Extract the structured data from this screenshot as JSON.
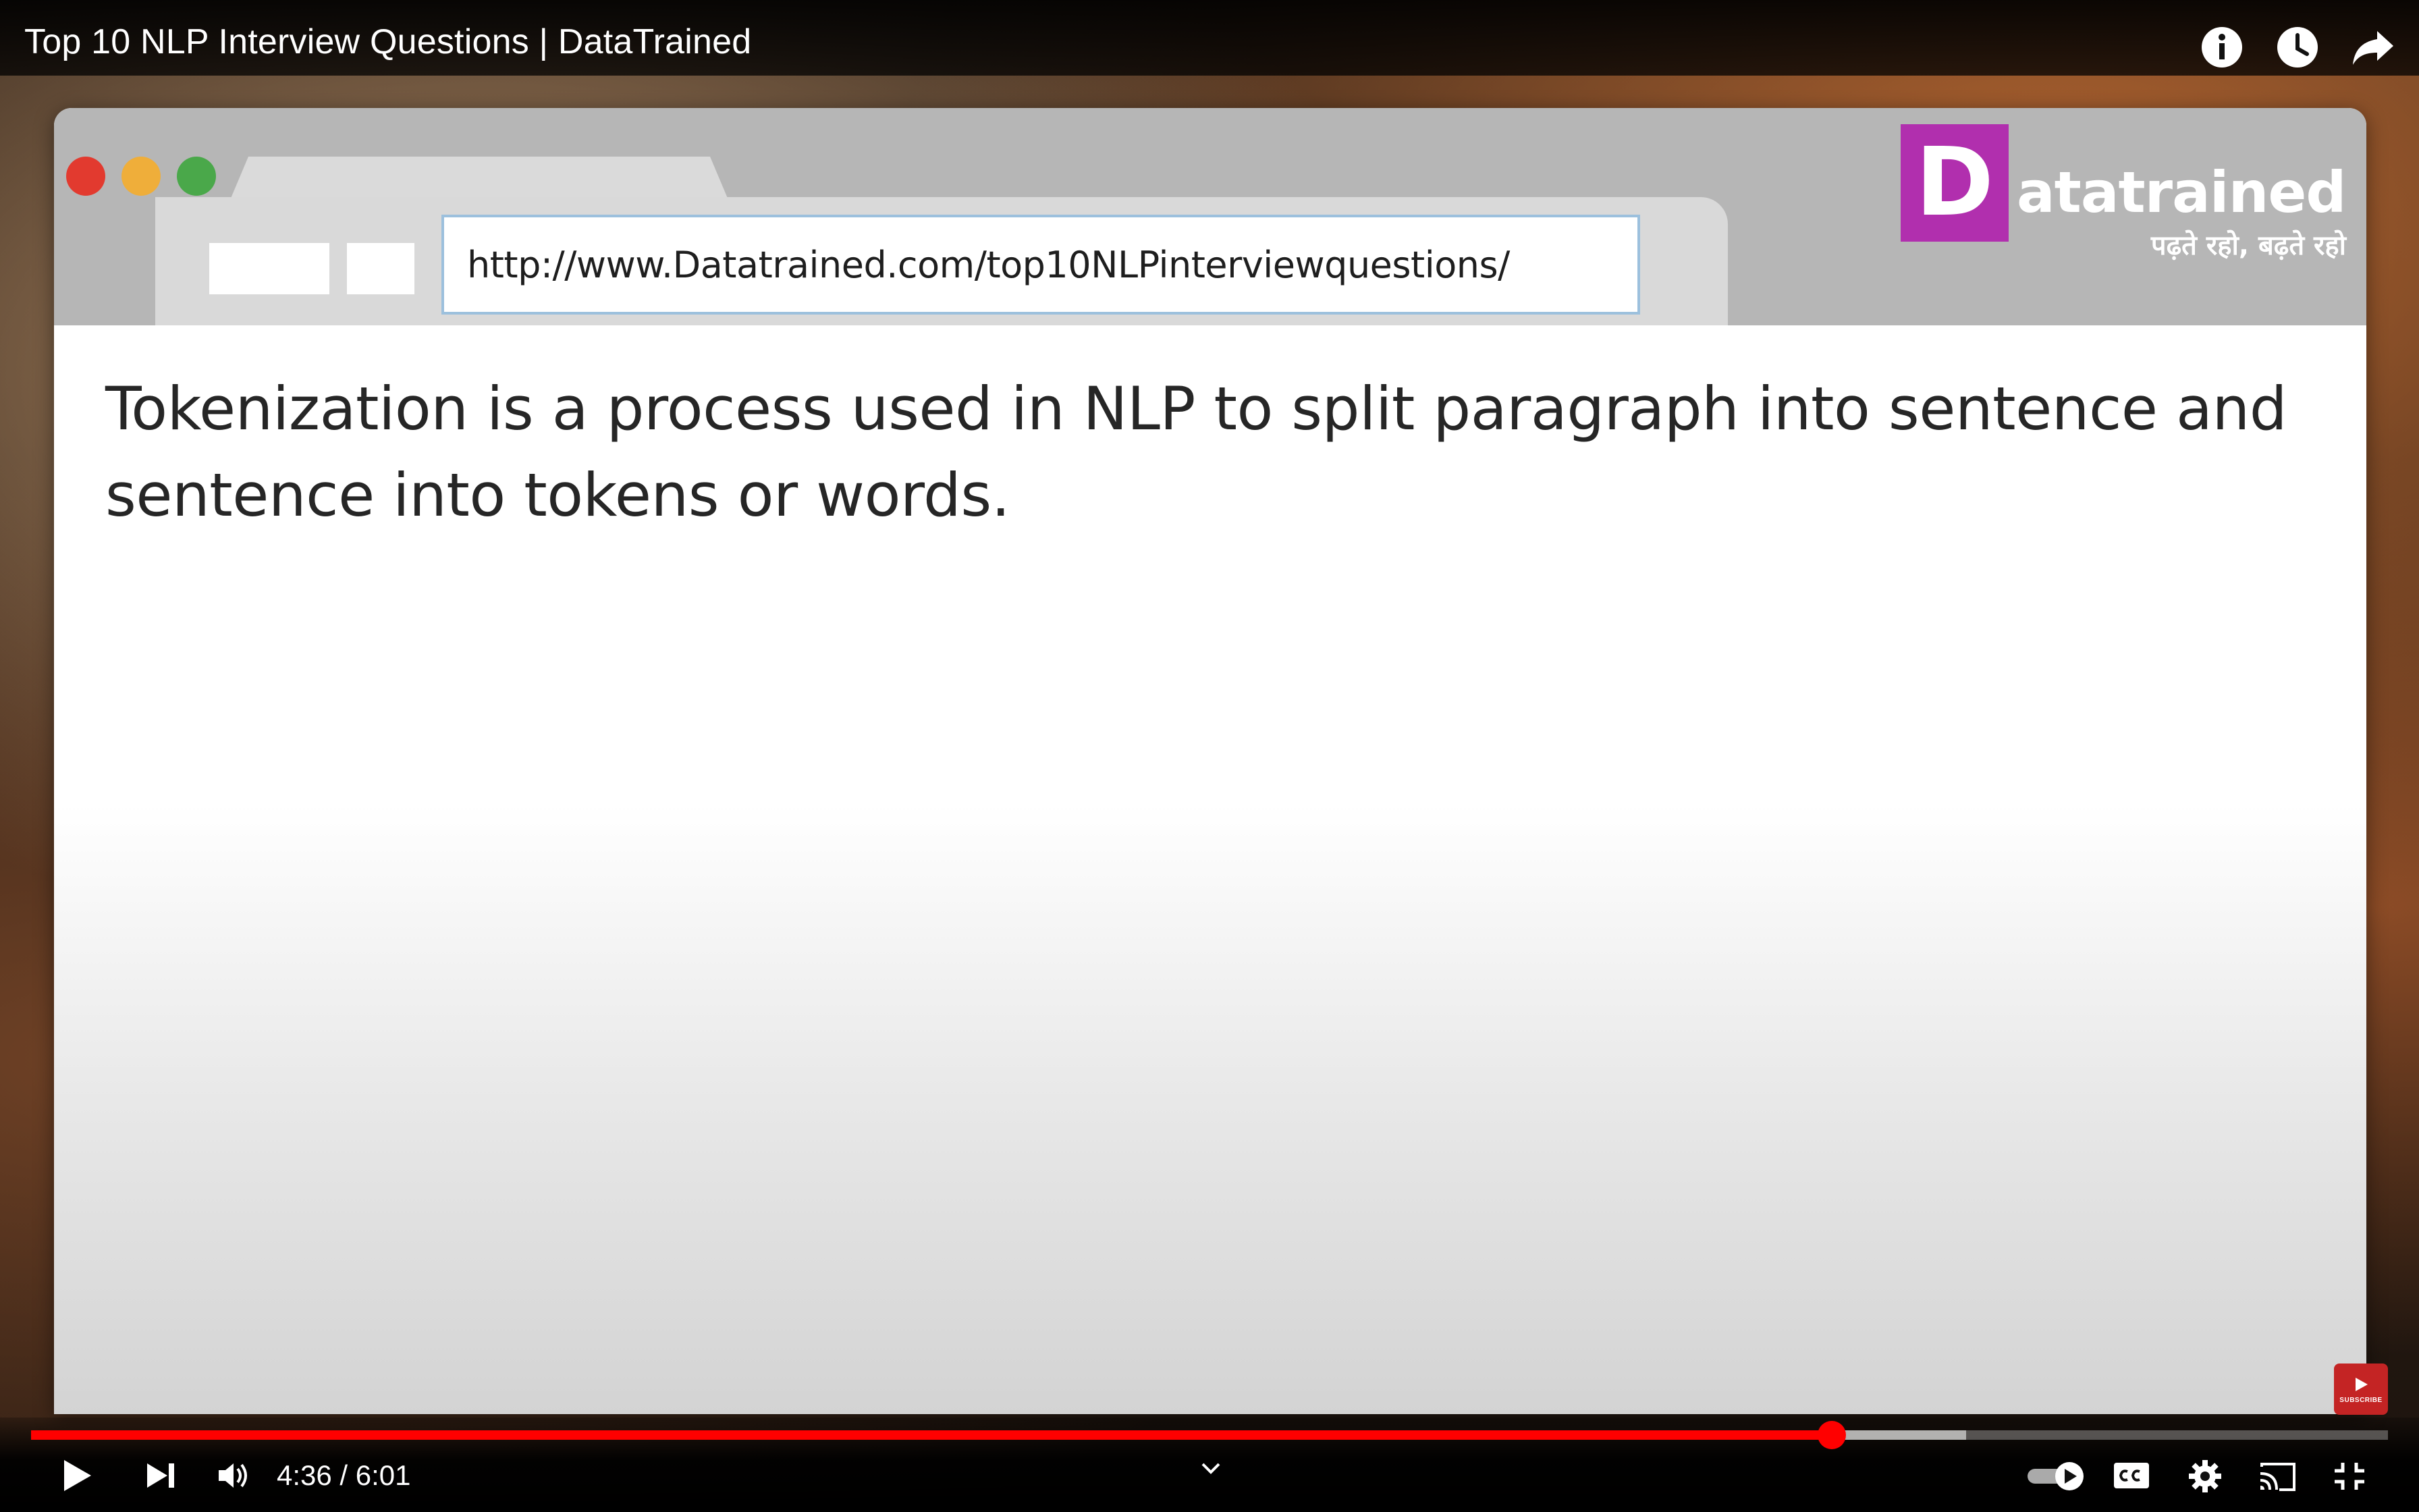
{
  "video": {
    "title": "Top 10 NLP Interview Questions | DataTrained"
  },
  "browser": {
    "url": "http://www.Datatrained.com/top10NLPinterviewquestions/"
  },
  "logo": {
    "letter": "D",
    "name": "atatrained",
    "tagline": "पढ़ते रहो, बढ़ते रहो"
  },
  "slide": {
    "text": "Tokenization is a process used in NLP to split paragraph into sentence and sentence into tokens or words."
  },
  "subscribe_badge": {
    "label": "SUBSCRIBE"
  },
  "player": {
    "current_time": "4:36",
    "separator": " / ",
    "duration": "6:01",
    "played_fraction": 0.764,
    "buffered_fraction": 0.821,
    "accent_color": "#ff0000"
  },
  "icons": {
    "info": "info-icon",
    "watch_later": "clock-icon",
    "share": "share-icon",
    "play": "play-icon",
    "next": "next-icon",
    "volume": "volume-icon",
    "chapters": "chevron-down-icon",
    "autoplay": "autoplay-toggle-icon",
    "captions": "cc-icon",
    "settings": "gear-icon",
    "cast": "cast-icon",
    "fullscreen_exit": "exit-fullscreen-icon"
  }
}
